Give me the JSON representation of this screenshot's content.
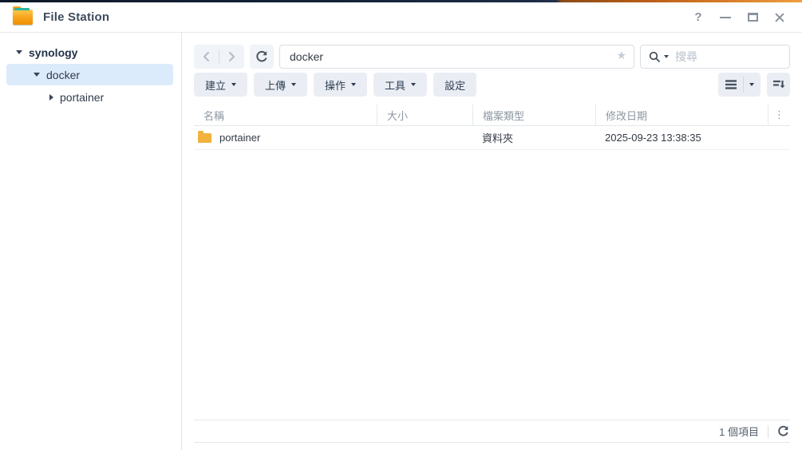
{
  "window": {
    "title": "File Station",
    "help_glyph": "?"
  },
  "sidebar": {
    "items": [
      {
        "label": "synology",
        "level": 1,
        "state": "expanded",
        "selected": false
      },
      {
        "label": "docker",
        "level": 2,
        "state": "expanded",
        "selected": true
      },
      {
        "label": "portainer",
        "level": 3,
        "state": "collapsed",
        "selected": false
      }
    ]
  },
  "toolbar": {
    "path_value": "docker",
    "star_glyph": "★",
    "search_placeholder": "搜尋",
    "buttons": [
      {
        "label": "建立",
        "dropdown": true
      },
      {
        "label": "上傳",
        "dropdown": true
      },
      {
        "label": "操作",
        "dropdown": true
      },
      {
        "label": "工具",
        "dropdown": true
      },
      {
        "label": "設定",
        "dropdown": false
      }
    ],
    "icons": [
      "back-icon",
      "forward-icon",
      "refresh-icon",
      "list-view-icon",
      "sort-icon",
      "search-icon",
      "favorite-star-icon"
    ]
  },
  "table": {
    "columns": [
      "名稱",
      "大小",
      "檔案類型",
      "修改日期"
    ],
    "menu_glyph": "⋮",
    "rows": [
      {
        "name": "portainer",
        "size": "",
        "type": "資料夾",
        "modified": "2025-09-23 13:38:35",
        "icon": "folder-icon"
      }
    ]
  },
  "statusbar": {
    "items_count": "1 個項目"
  },
  "colors": {
    "folder_yellow": "#f1b23e",
    "selected_row_bg": "#dcebfb",
    "button_bg": "#eaeef4",
    "header_text": "#8c96a2"
  }
}
